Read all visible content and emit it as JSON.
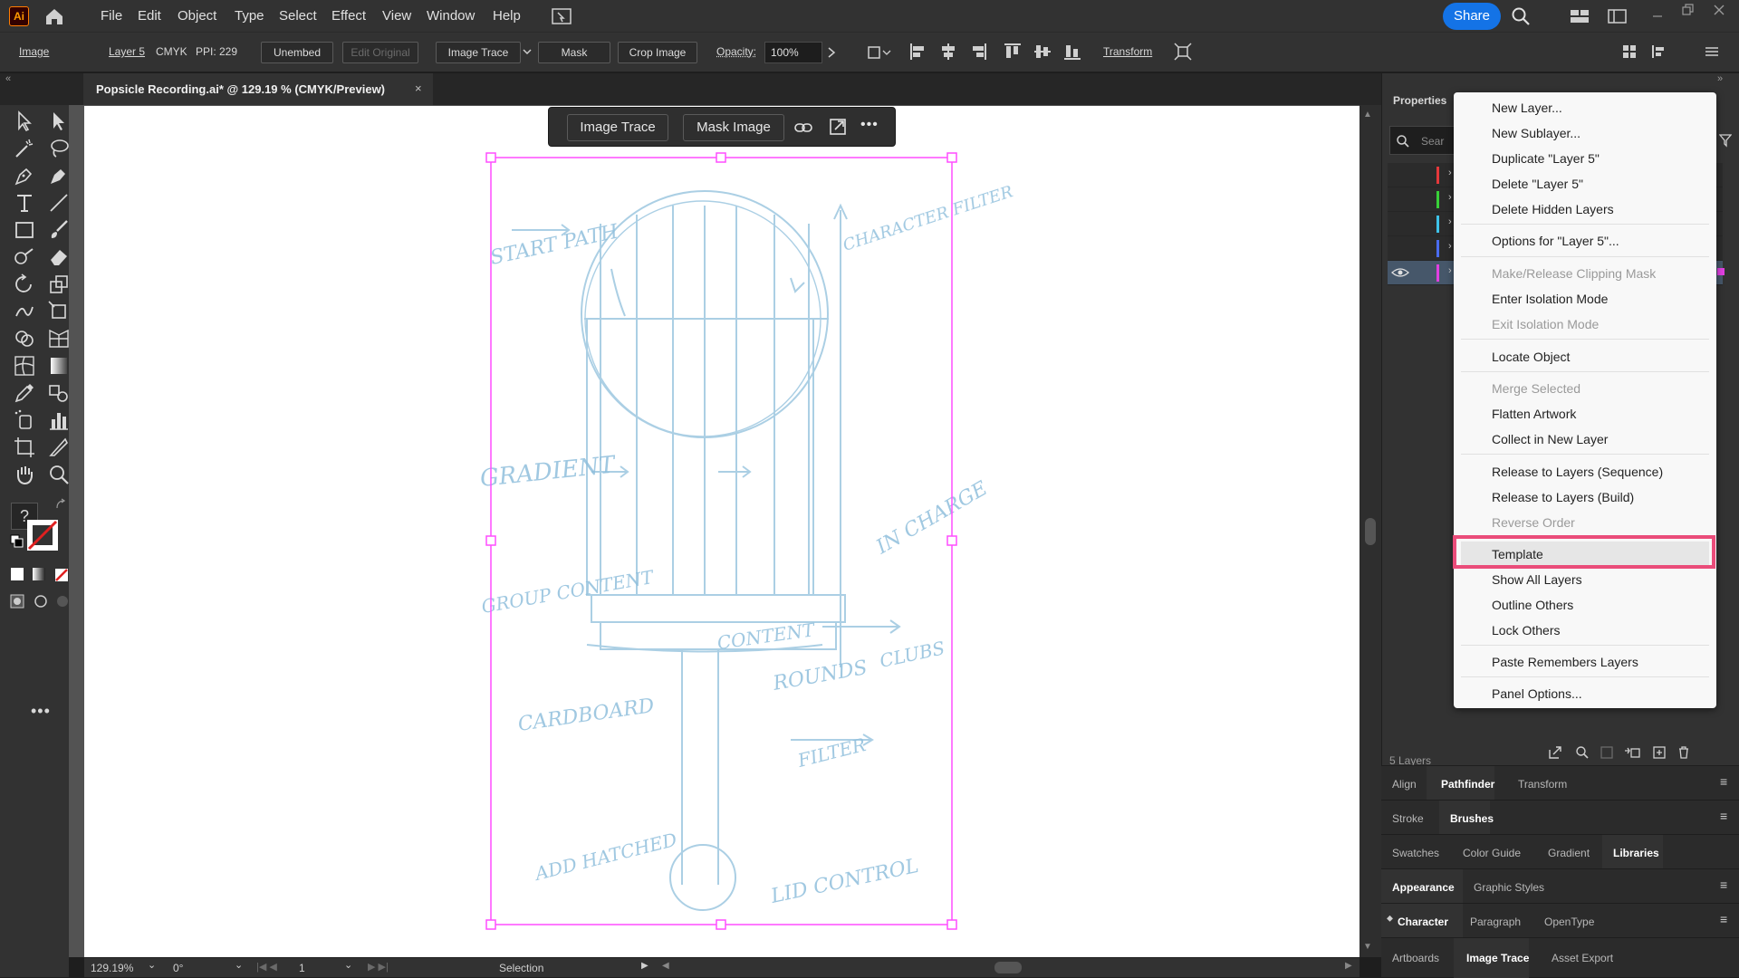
{
  "app": {
    "logo": "Ai",
    "menu": [
      "File",
      "Edit",
      "Object",
      "Type",
      "Select",
      "Effect",
      "View",
      "Window",
      "Help"
    ],
    "share_label": "Share"
  },
  "control_bar": {
    "object_type": "Image",
    "layer": "Layer 5",
    "color_mode": "CMYK",
    "ppi": "PPI: 229",
    "unembed": "Unembed",
    "edit_original": "Edit Original",
    "image_trace": "Image Trace",
    "mask": "Mask",
    "crop_image": "Crop Image",
    "opacity_label": "Opacity:",
    "opacity_value": "100%",
    "transform": "Transform"
  },
  "document": {
    "tab_title": "Popsicle Recording.ai* @ 129.19 % (CMYK/Preview)",
    "close": "×"
  },
  "contextual_task_bar": {
    "image_trace": "Image Trace",
    "mask_image": "Mask Image"
  },
  "status_bar": {
    "zoom": "129.19%",
    "rotation": "0°",
    "artboard_num": "1",
    "tool": "Selection"
  },
  "right_panel": {
    "properties_tab": "Properties",
    "search_placeholder": "Sear",
    "layers_count": "5 Layers",
    "groups": [
      {
        "tabs": [
          "Align",
          "Pathfinder",
          "Transform"
        ],
        "active": 1
      },
      {
        "tabs": [
          "Stroke",
          "Brushes"
        ],
        "active": 1
      },
      {
        "tabs": [
          "Swatches",
          "Color Guide",
          "Gradient",
          "Libraries"
        ],
        "active": 3
      },
      {
        "tabs": [
          "Appearance",
          "Graphic Styles"
        ],
        "active": 0
      },
      {
        "tabs": [
          "Character",
          "Paragraph",
          "OpenType"
        ],
        "active": 0
      },
      {
        "tabs": [
          "Artboards",
          "Image Trace",
          "Asset Export"
        ],
        "active": 1
      }
    ],
    "layer_colors": [
      "#e5383b",
      "#38d038",
      "#3ec2e8",
      "#4a6cf0",
      "#e040e0"
    ]
  },
  "context_menu": {
    "items": [
      {
        "label": "New Layer...",
        "disabled": false
      },
      {
        "label": "New Sublayer...",
        "disabled": false
      },
      {
        "label": "Duplicate \"Layer 5\"",
        "disabled": false
      },
      {
        "label": "Delete \"Layer 5\"",
        "disabled": false
      },
      {
        "label": "Delete Hidden Layers",
        "disabled": false
      },
      {
        "label": "Options for \"Layer 5\"...",
        "disabled": false
      },
      {
        "label": "Make/Release Clipping Mask",
        "disabled": true
      },
      {
        "label": "Enter Isolation Mode",
        "disabled": false
      },
      {
        "label": "Exit Isolation Mode",
        "disabled": true
      },
      {
        "label": "Locate Object",
        "disabled": false
      },
      {
        "label": "Merge Selected",
        "disabled": true
      },
      {
        "label": "Flatten Artwork",
        "disabled": false
      },
      {
        "label": "Collect in New Layer",
        "disabled": false
      },
      {
        "label": "Release to Layers (Sequence)",
        "disabled": false
      },
      {
        "label": "Release to Layers (Build)",
        "disabled": false
      },
      {
        "label": "Reverse Order",
        "disabled": true
      },
      {
        "label": "Template",
        "disabled": false,
        "highlighted": true
      },
      {
        "label": "Show All Layers",
        "disabled": false
      },
      {
        "label": "Outline Others",
        "disabled": false
      },
      {
        "label": "Lock Others",
        "disabled": false
      },
      {
        "label": "Paste Remembers Layers",
        "disabled": false
      },
      {
        "label": "Panel Options...",
        "disabled": false
      }
    ]
  },
  "sketch_notes": {
    "start_path": "START PATH",
    "gradient": "GRADIENT",
    "group_content": "GROUP CONTENT",
    "content": "CONTENT",
    "cardboard": "CARDBOARD",
    "rounds": "ROUNDS",
    "add_hatched": "ADD HATCHED",
    "lid_control": "LID CONTROL",
    "in_charge": "IN CHARGE",
    "clubs": "CLUBS",
    "filter": "FILTER",
    "character_filter": "CHARACTER FILTER"
  },
  "colors": {
    "accent": "#1473e6",
    "selection": "#ff4dff",
    "highlight": "#ea4c7a",
    "sketch": "#8fbfdc"
  }
}
